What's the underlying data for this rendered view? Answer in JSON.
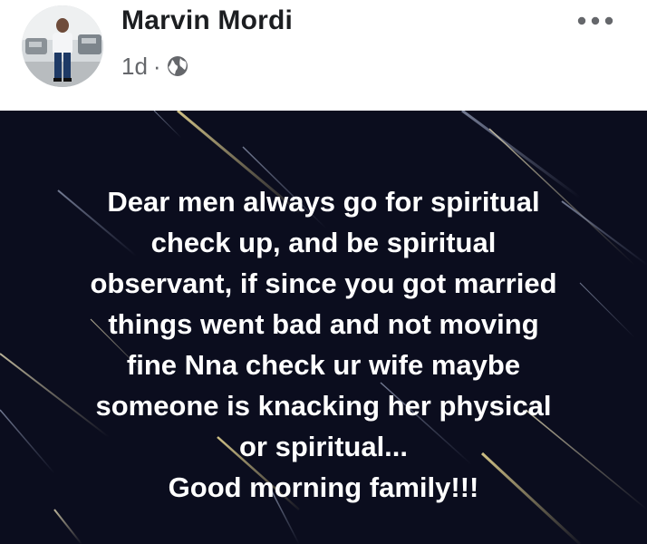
{
  "post": {
    "author_name": "Marvin Mordi",
    "time": "1d",
    "separator": "·",
    "audience_icon": "globe-icon",
    "more_icon": "more-options-icon",
    "text_lines": [
      "Dear men always go for spiritual",
      "check up,  and be spiritual",
      "observant, if since you got married",
      "things went bad and not moving",
      "fine Nna check ur wife maybe",
      "someone is knacking her physical",
      "or spiritual...",
      "Good morning family!!!"
    ]
  },
  "colors": {
    "name": "#1c1e21",
    "meta": "#65676b",
    "image_background": "#0b0d1e",
    "post_text": "#ffffff"
  }
}
